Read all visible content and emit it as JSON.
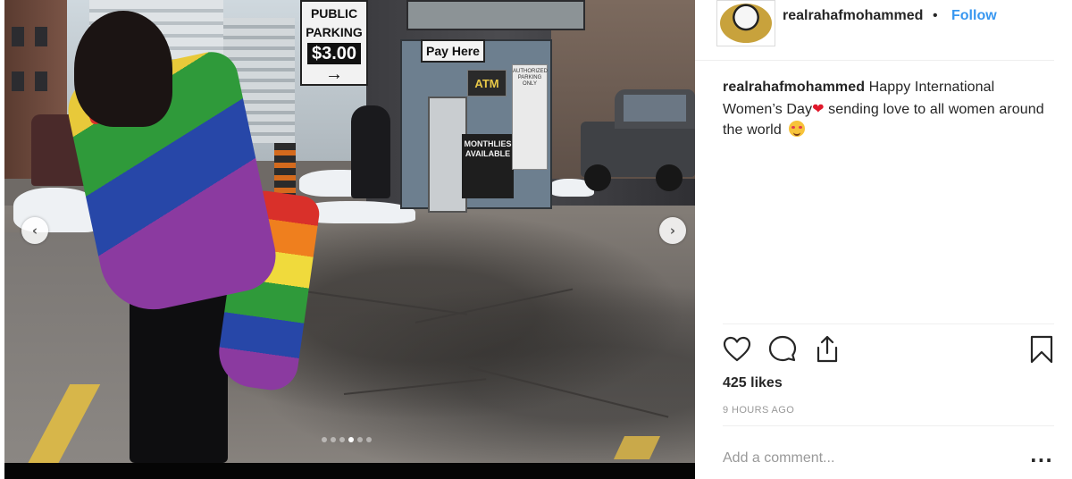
{
  "post": {
    "username": "realrahafmohammed",
    "separator": "•",
    "follow_label": "Follow",
    "caption": {
      "username": "realrahafmohammed",
      "text_part1": " Happy International Women’s Day",
      "heart": "❤",
      "text_part2": " sending love to all women around the world "
    },
    "likes": "425 likes",
    "timestamp": "9 HOURS AGO",
    "comment_placeholder": "Add a comment...",
    "more_label": "..."
  },
  "photo": {
    "sign_line1": "PUBLIC",
    "sign_line2": "PARKING",
    "sign_price": "$3.00",
    "sign_arrow": "→",
    "pay_here": "Pay Here",
    "atm": "ATM",
    "monthly_line1": "MONTHLIES",
    "monthly_line2": "AVAILABLE",
    "notice_text": "AUTHORIZED PARKING ONLY",
    "carousel_dots": 6,
    "active_dot": 4
  },
  "carousel": {
    "prev_icon": "‹",
    "next_icon": "›"
  },
  "colors": {
    "link": "#3897f0",
    "text": "#262626",
    "muted": "#999999",
    "divider": "#efefef"
  },
  "icons": [
    "heart-icon",
    "comment-icon",
    "share-icon",
    "bookmark-icon",
    "chevron-left-icon",
    "chevron-right-icon",
    "more-icon"
  ]
}
